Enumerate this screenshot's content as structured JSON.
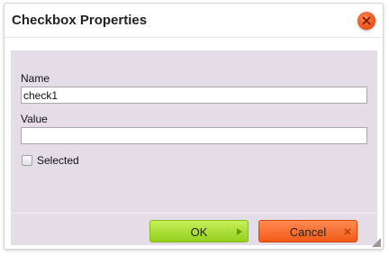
{
  "dialog": {
    "title": "Checkbox Properties",
    "close_icon": "close-icon",
    "fields": {
      "name": {
        "label": "Name",
        "value": "check1"
      },
      "value": {
        "label": "Value",
        "value": ""
      }
    },
    "selected": {
      "label": "Selected",
      "checked": false
    },
    "buttons": {
      "ok": {
        "label": "OK",
        "icon": "arrow-right-icon"
      },
      "cancel": {
        "label": "Cancel",
        "icon": "close-icon"
      }
    }
  },
  "colors": {
    "body_background": "#e4dde8",
    "close_button": "#f25a1e",
    "ok_button": "#94d01c",
    "cancel_button": "#f15a18"
  }
}
